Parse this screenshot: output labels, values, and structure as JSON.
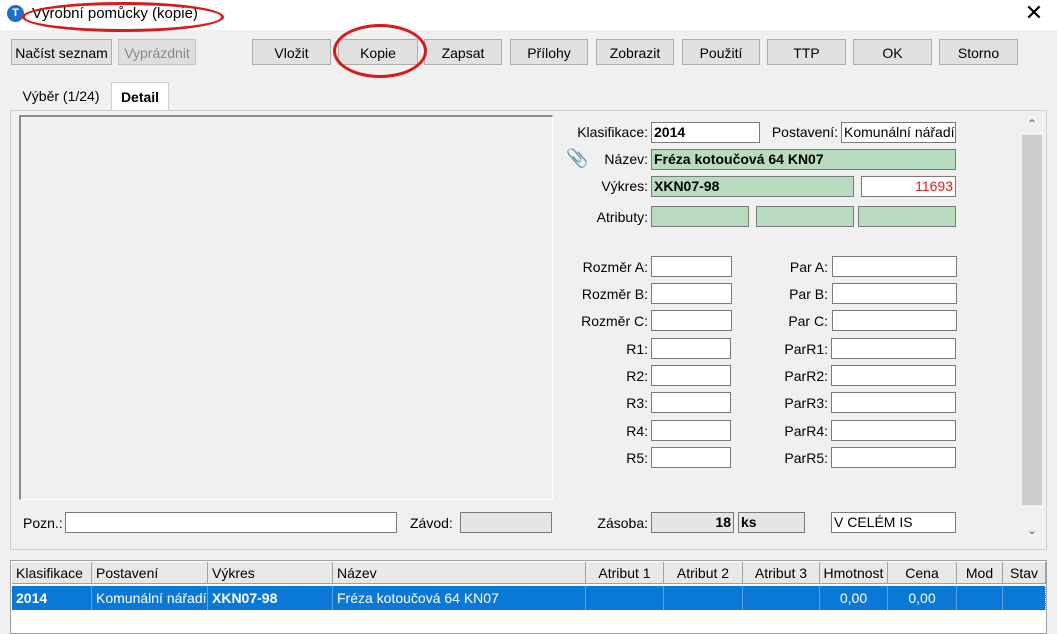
{
  "window": {
    "title": "Výrobní pomůcky (kopie)",
    "icon": "app-logo-icon",
    "close": "✕"
  },
  "toolbar": {
    "nacist": "Načíst seznam",
    "vyprazdnit": "Vyprázdnit",
    "vlozit": "Vložit",
    "kopie": "Kopie",
    "zapsat": "Zapsat",
    "prilohy": "Přílohy",
    "zobrazit": "Zobrazit",
    "pouziti": "Použití",
    "ttp": "TTP",
    "ok": "OK",
    "storno": "Storno"
  },
  "tabs": {
    "vyber": "Výběr (1/24)",
    "detail": "Detail"
  },
  "detail": {
    "klasifikace_label": "Klasifikace:",
    "klasifikace": "2014",
    "postaveni_label": "Postavení:",
    "postaveni": "Komunální nářadí",
    "nazev_label": "Název:",
    "nazev": "Fréza kotoučová 64 KN07",
    "vykres_label": "Výkres:",
    "vykres": "XKN07-98",
    "vykres_num": "11693",
    "atributy_label": "Atributy:",
    "rozmer_a": "Rozměr A:",
    "rozmer_b": "Rozměr B:",
    "rozmer_c": "Rozměr C:",
    "r1": "R1:",
    "r2": "R2:",
    "r3": "R3:",
    "r4": "R4:",
    "r5": "R5:",
    "par_a": "Par A:",
    "par_b": "Par B:",
    "par_c": "Par C:",
    "par_r1": "ParR1:",
    "par_r2": "ParR2:",
    "par_r3": "ParR3:",
    "par_r4": "ParR4:",
    "par_r5": "ParR5:",
    "pozn_label": "Pozn.:",
    "zavod_label": "Závod:",
    "zasoba_label": "Zásoba:",
    "zasoba_value": "18",
    "zasoba_unit": "ks",
    "scope": "V CELÉM IS"
  },
  "grid": {
    "headers": [
      "Klasifikace",
      "Postavení",
      "Výkres",
      "Název",
      "Atribut 1",
      "Atribut 2",
      "Atribut 3",
      "Hmotnost",
      "Cena",
      "Mod",
      "Stav"
    ],
    "row": [
      "2014",
      "Komunální nářadí",
      "XKN07-98",
      "Fréza kotoučová 64 KN07",
      "",
      "",
      "",
      "0,00",
      "0,00",
      "",
      ""
    ]
  },
  "colors": {
    "annotation": "#d81a1a",
    "selection": "#0a78d7",
    "green_field": "#b9dbbf"
  }
}
